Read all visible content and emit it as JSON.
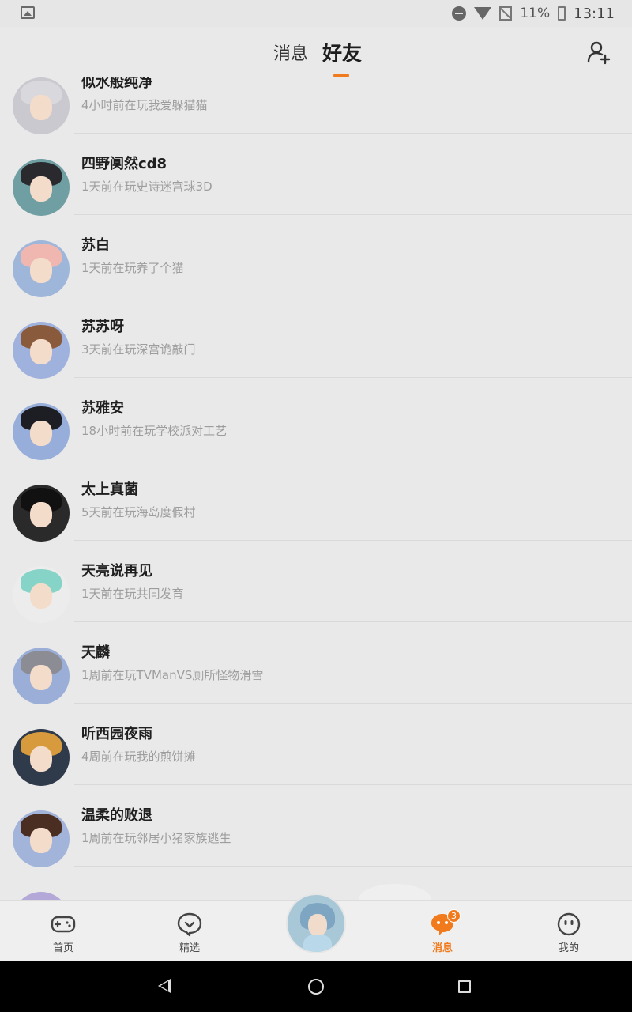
{
  "status_bar": {
    "battery": "11%",
    "time": "13:11"
  },
  "header": {
    "tabs": [
      {
        "label": "消息",
        "active": false
      },
      {
        "label": "好友",
        "active": true
      }
    ],
    "accent_color": "#f07a1c"
  },
  "friends": [
    {
      "name": "似水般纯净",
      "status": "4小时前在玩我爱躲猫猫",
      "hair_color": "#d9d9dd",
      "bg_color": "#c9c9cf"
    },
    {
      "name": "四野阒然cd8",
      "status": "1天前在玩史诗迷宫球3D",
      "hair_color": "#2a2a2e",
      "bg_color": "#6f9fa3"
    },
    {
      "name": "苏白",
      "status": "1天前在玩养了个猫",
      "hair_color": "#f0b7b0",
      "bg_color": "#9fb6db"
    },
    {
      "name": "苏苏呀",
      "status": "3天前在玩深宫诡敲门",
      "hair_color": "#8a5a3c",
      "bg_color": "#9fb2dd"
    },
    {
      "name": "苏雅安",
      "status": "18小时前在玩学校派对工艺",
      "hair_color": "#1d1d24",
      "bg_color": "#97aedb"
    },
    {
      "name": "太上真菌",
      "status": "5天前在玩海岛度假村",
      "hair_color": "#111111",
      "bg_color": "#2a2a2a"
    },
    {
      "name": "天亮说再见",
      "status": "1天前在玩共同发育",
      "hair_color": "#86d3c8",
      "bg_color": "#ececec"
    },
    {
      "name": "天麟",
      "status": "1周前在玩TVManVS厕所怪物滑雪",
      "hair_color": "#8c8c95",
      "bg_color": "#9aaed8"
    },
    {
      "name": "听西园夜雨",
      "status": "4周前在玩我的煎饼摊",
      "hair_color": "#d79b3d",
      "bg_color": "#2f3a4a"
    },
    {
      "name": "温柔的败退",
      "status": "1周前在玩邻居小猪家族逃生",
      "hair_color": "#4a2e22",
      "bg_color": "#a2b4da"
    }
  ],
  "bottom_nav": {
    "items": [
      {
        "label": "首页",
        "icon": "gamepad-icon"
      },
      {
        "label": "精选",
        "icon": "heart-chat-icon"
      },
      {
        "label": "消息",
        "icon": "message-icon",
        "active": true,
        "badge": "3"
      },
      {
        "label": "我的",
        "icon": "smiley-icon"
      }
    ]
  }
}
